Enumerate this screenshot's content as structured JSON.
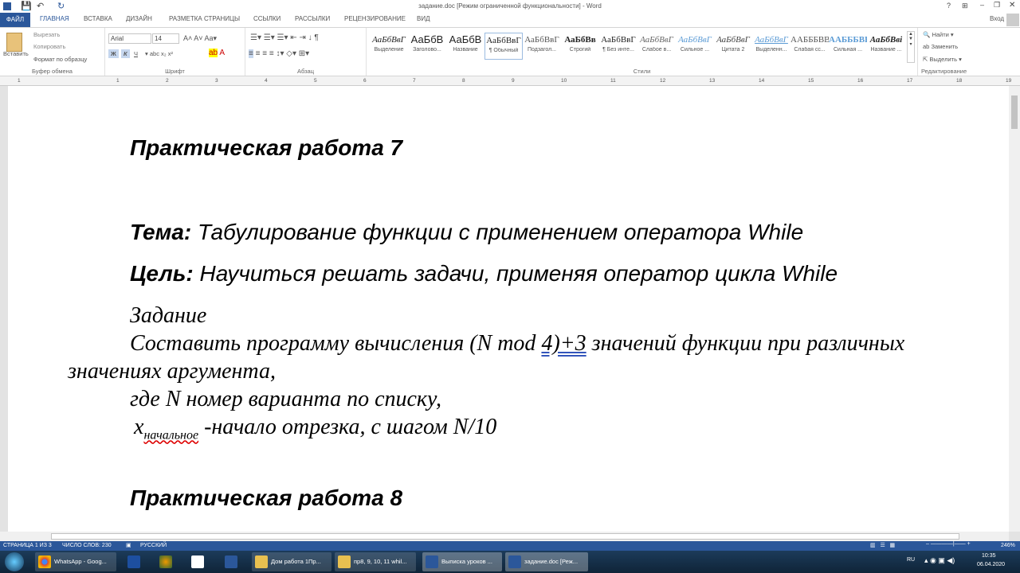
{
  "window": {
    "title": "задание.doc [Режим ограниченной функциональности] - Word",
    "help": "?",
    "login": "Вход"
  },
  "tabs": [
    "ФАЙЛ",
    "ГЛАВНАЯ",
    "ВСТАВКА",
    "ДИЗАЙН",
    "РАЗМЕТКА СТРАНИЦЫ",
    "ССЫЛКИ",
    "РАССЫЛКИ",
    "РЕЦЕНЗИРОВАНИЕ",
    "ВИД"
  ],
  "clipboard": {
    "paste": "Вставить",
    "cut": "Вырезать",
    "copy": "Копировать",
    "format": "Формат по образцу",
    "label": "Буфер обмена"
  },
  "font": {
    "name": "Arial",
    "size": "14",
    "label": "Шрифт",
    "bold": "Ж",
    "italic": "К",
    "underline": "Ч"
  },
  "paragraph": {
    "label": "Абзац"
  },
  "styles": {
    "label": "Стили",
    "items": [
      {
        "preview": "АаБбВвГ",
        "name": "Выделение"
      },
      {
        "preview": "АаБбВ",
        "name": "Заголово..."
      },
      {
        "preview": "АаБбВ",
        "name": "Название"
      },
      {
        "preview": "АаБбВвГ",
        "name": "¶ Обычный"
      },
      {
        "preview": "АаБбВвГ",
        "name": "Подзагол..."
      },
      {
        "preview": "АаБбВв",
        "name": "Строгий"
      },
      {
        "preview": "АаБбВвГ",
        "name": "¶ Без инте..."
      },
      {
        "preview": "АаБбВвГ",
        "name": "Слабое в..."
      },
      {
        "preview": "АаБбВвГ",
        "name": "Сильное ..."
      },
      {
        "preview": "АаБбВвГ",
        "name": "Цитата 2"
      },
      {
        "preview": "АаБбВвГ",
        "name": "Выделенн..."
      },
      {
        "preview": "ААБББВВІ",
        "name": "Слабая сс..."
      },
      {
        "preview": "ААБББВВ",
        "name": "Сильная ..."
      },
      {
        "preview": "АаБбВві",
        "name": "Название ..."
      }
    ]
  },
  "editing": {
    "find": "Найти",
    "replace": "Заменить",
    "select": "Выделить",
    "label": "Редактирование"
  },
  "ruler": [
    "1",
    "1",
    "2",
    "3",
    "4",
    "5",
    "6",
    "7",
    "8",
    "9",
    "10",
    "11",
    "12",
    "13",
    "14",
    "15",
    "16",
    "17",
    "18",
    "19"
  ],
  "document": {
    "heading1": "Практическая работа 7",
    "topic_label": "Тема:",
    "topic": " Табулирование функции с применением оператора While",
    "goal_label": "Цель:",
    "goal": " Научиться решать задачи, применяя оператор цикла While",
    "task_title": "Задание",
    "task_line1a": "Составить программу вычисления (N mod ",
    "task_line1b": "4)+3",
    "task_line1c": "   значений функции при различных",
    "task_line2": "значениях аргумента,",
    "task_line3": "где N номер варианта по списку,",
    "task_line4a": "x",
    "task_line4b": "начальное",
    "task_line4c": " -начало отрезка, с шагом N/10",
    "heading2": "Практическая работа 8"
  },
  "status": {
    "page": "СТРАНИЦА 1 ИЗ 3",
    "words": "ЧИСЛО СЛОВ: 230",
    "lang": "РУССКИЙ",
    "zoom": "246%"
  },
  "taskbar": {
    "items": [
      "WhatsApp - Goog...",
      "Дом работа 1Пр...",
      "пр8, 9, 10, 11 whil...",
      "Выписка уроков ...",
      "задание.doc [Реж..."
    ],
    "lang": "RU",
    "time": "10:35",
    "date": "06.04.2020"
  },
  "colors": {
    "accent": "#2b579a"
  }
}
